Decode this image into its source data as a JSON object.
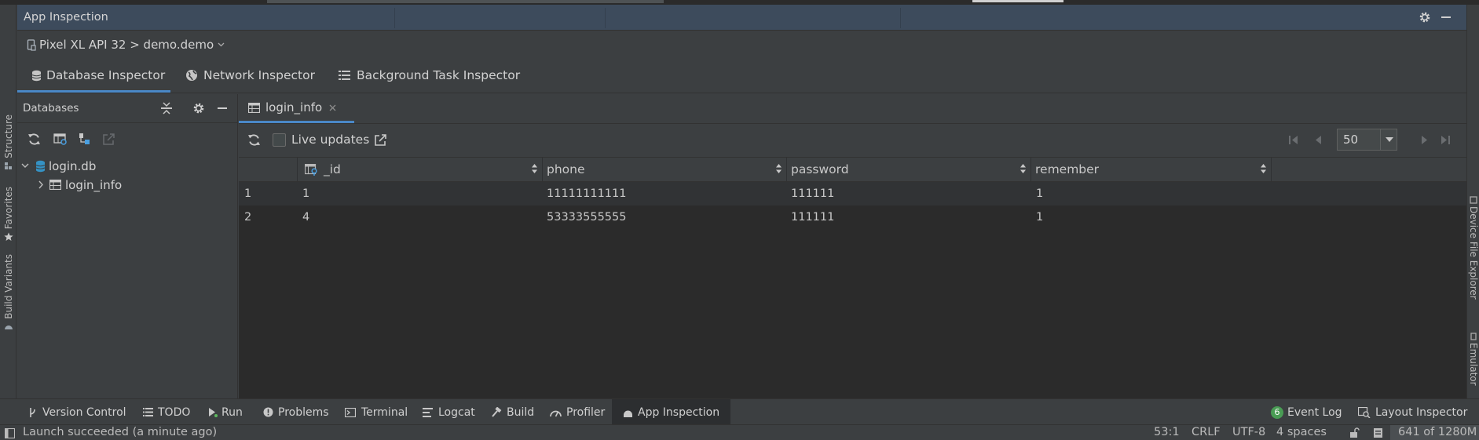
{
  "window": {
    "title": "App Inspection"
  },
  "device": {
    "label": "Pixel XL API 32 > demo.demo"
  },
  "tabs": [
    {
      "label": "Database Inspector",
      "active": true
    },
    {
      "label": "Network Inspector",
      "active": false
    },
    {
      "label": "Background Task Inspector",
      "active": false
    }
  ],
  "databases_panel": {
    "title": "Databases",
    "tree": {
      "database": "login.db",
      "tables": [
        "login_info"
      ]
    }
  },
  "table_tab": {
    "label": "login_info"
  },
  "toolbar": {
    "live_updates_label": "Live updates",
    "live_updates_checked": false,
    "page_size": "50"
  },
  "table": {
    "columns": [
      "_id",
      "phone",
      "password",
      "remember"
    ],
    "rows": [
      {
        "num": "1",
        "_id": "1",
        "phone": "11111111111",
        "password": "111111",
        "remember": "1"
      },
      {
        "num": "2",
        "_id": "4",
        "phone": "53333555555",
        "password": "111111",
        "remember": "1"
      }
    ]
  },
  "left_stripe": [
    "Structure",
    "Favorites",
    "Build Variants"
  ],
  "right_stripe": [
    "Device File Explorer",
    "Emulator"
  ],
  "bottom_tabs": [
    {
      "label": "Version Control",
      "icon": "branch-icon"
    },
    {
      "label": "TODO",
      "icon": "list-icon"
    },
    {
      "label": "Run",
      "icon": "run-icon"
    },
    {
      "label": "Problems",
      "icon": "problems-icon"
    },
    {
      "label": "Terminal",
      "icon": "terminal-icon"
    },
    {
      "label": "Logcat",
      "icon": "logcat-icon"
    },
    {
      "label": "Build",
      "icon": "hammer-icon"
    },
    {
      "label": "Profiler",
      "icon": "gauge-icon"
    },
    {
      "label": "App Inspection",
      "icon": "inspection-icon",
      "active": true
    }
  ],
  "bottom_right": {
    "event_log_badge": "6",
    "event_log_label": "Event Log",
    "layout_inspector_label": "Layout Inspector"
  },
  "status": {
    "message": "Launch succeeded (a minute ago)",
    "position": "53:1",
    "line_separator": "CRLF",
    "encoding": "UTF-8",
    "indent": "4 spaces",
    "memory": "641 of 1280M"
  },
  "colors": {
    "accent": "#4a88c7",
    "header_bg": "#3d4b5c",
    "panel_bg": "#3c3f41",
    "table_bg": "#2b2b2b",
    "db_icon": "#3592c4"
  }
}
